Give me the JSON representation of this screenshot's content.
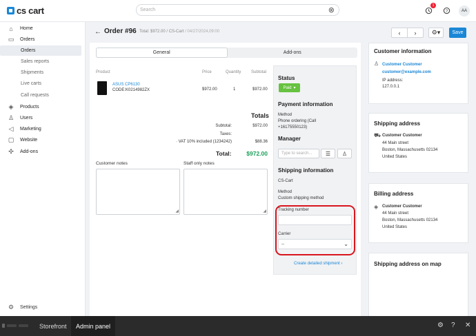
{
  "app": {
    "logo_text": "cs cart"
  },
  "topbar": {
    "search_placeholder": "Search",
    "notif_count": "1",
    "avatar": "AA"
  },
  "sidebar": {
    "items": [
      {
        "label": "Home",
        "icon": "home-icon"
      },
      {
        "label": "Orders",
        "icon": "inbox-icon"
      },
      {
        "label": "Orders",
        "sub": true,
        "active": true
      },
      {
        "label": "Sales reports",
        "sub": true
      },
      {
        "label": "Shipments",
        "sub": true
      },
      {
        "label": "Live carts",
        "sub": true
      },
      {
        "label": "Call requests",
        "sub": true
      },
      {
        "label": "Products",
        "icon": "tag-icon"
      },
      {
        "label": "Users",
        "icon": "user-icon"
      },
      {
        "label": "Marketing",
        "icon": "megaphone-icon"
      },
      {
        "label": "Website",
        "icon": "monitor-icon"
      },
      {
        "label": "Add-ons",
        "icon": "puzzle-icon"
      }
    ],
    "settings_label": "Settings"
  },
  "header": {
    "title": "Order #96",
    "total": "Total: $972.00",
    "store": "/ CS-Cart",
    "date": "/ 04/27/2024,09:00",
    "save_label": "Save"
  },
  "tabs": [
    "General",
    "Add-ons"
  ],
  "products_table": {
    "columns": [
      "Product",
      "Price",
      "Quantity",
      "Subtotal"
    ],
    "rows": [
      {
        "name": "ASUS CP6130",
        "code": "CODE:K0214982ZX",
        "price": "$972.00",
        "qty": "1",
        "subtotal": "$972.00"
      }
    ]
  },
  "totals": {
    "heading": "Totals",
    "subtotal_label": "Subtotal:",
    "subtotal_value": "$972.00",
    "taxes_label": "Taxes:",
    "vat_label": "· VAT 10% included (1234242)",
    "vat_value": "$88.36",
    "total_label": "Total:",
    "total_value": "$972.00"
  },
  "notes": {
    "customer_label": "Customer notes",
    "staff_label": "Staff only notes"
  },
  "status": {
    "heading": "Status",
    "value": "Paid"
  },
  "payment": {
    "heading": "Payment information",
    "method_label": "Method",
    "method_value": "Phone ordering (Call +16175550123)"
  },
  "manager": {
    "heading": "Manager",
    "placeholder": "Type to search..."
  },
  "shipping_info": {
    "heading": "Shipping information",
    "store": "CS-Cart",
    "method_label": "Method",
    "method_value": "Custom shipping method",
    "tracking_label": "Tracking number",
    "carrier_label": "Carrier",
    "carrier_value": "--",
    "detailed_link": "Create detailed shipment"
  },
  "customer_info": {
    "heading": "Customer information",
    "name": "Customer Customer",
    "email": "customer@example.com",
    "ip_label": "IP address:",
    "ip": "127.0.0.1"
  },
  "shipping_address": {
    "heading": "Shipping address",
    "name": "Customer Customer",
    "street": "44 Main street",
    "city": "Boston, Massachusetts 02134",
    "country": "United States"
  },
  "billing_address": {
    "heading": "Billing address",
    "name": "Customer Customer",
    "street": "44 Main street",
    "city": "Boston, Massachusetts 02134",
    "country": "United States"
  },
  "map_card": {
    "heading": "Shipping address on map"
  },
  "bottombar": {
    "storefront": "Storefront",
    "admin": "Admin panel"
  },
  "colors": {
    "accent": "#1a87d6",
    "paid": "#66c240",
    "total": "#1aa05a",
    "highlight": "#d8141c"
  }
}
